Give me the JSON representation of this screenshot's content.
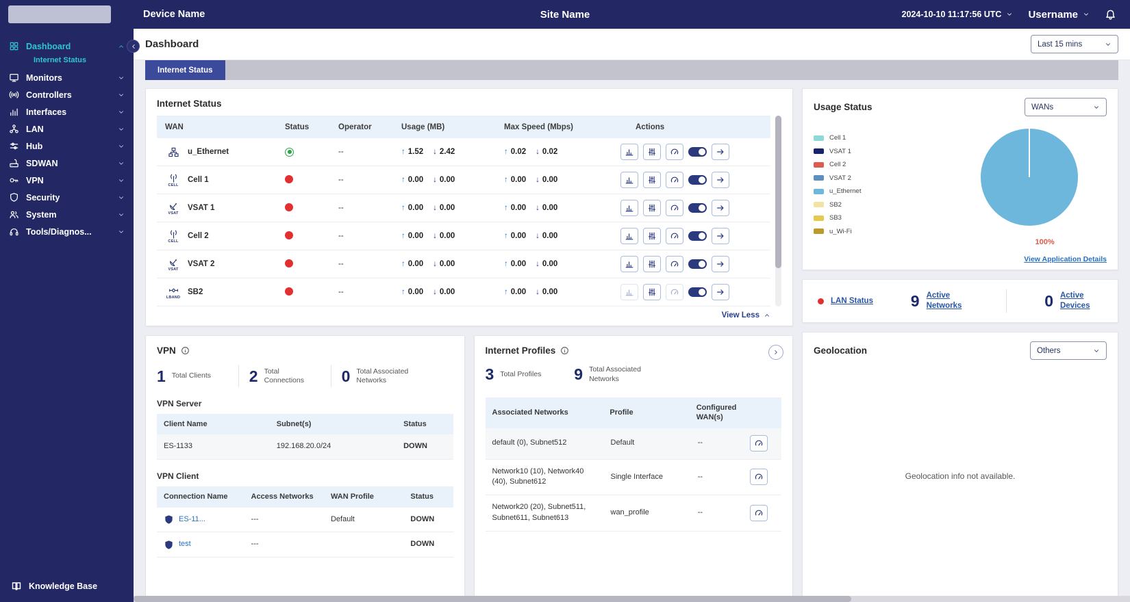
{
  "topbar": {
    "device_name": "Device Name",
    "site_name": "Site Name",
    "datetime": "2024-10-10 11:17:56 UTC",
    "username": "Username"
  },
  "sidebar": {
    "items": [
      {
        "label": "Dashboard"
      },
      {
        "label": "Internet Status"
      },
      {
        "label": "Monitors"
      },
      {
        "label": "Controllers"
      },
      {
        "label": "Interfaces"
      },
      {
        "label": "LAN"
      },
      {
        "label": "Hub"
      },
      {
        "label": "SDWAN"
      },
      {
        "label": "VPN"
      },
      {
        "label": "Security"
      },
      {
        "label": "System"
      },
      {
        "label": "Tools/Diagnos..."
      }
    ],
    "footer": "Knowledge Base"
  },
  "page": {
    "title": "Dashboard",
    "time_filter": "Last 15 mins",
    "tab": "Internet Status"
  },
  "icons": {
    "up_arrow": "↑",
    "down_arrow": "↓"
  },
  "internet_status": {
    "title": "Internet Status",
    "columns": [
      "WAN",
      "Status",
      "Operator",
      "Usage (MB)",
      "Max Speed (Mbps)",
      "Actions"
    ],
    "rows": [
      {
        "wan": "u_Ethernet",
        "type": "ethernet",
        "type_label": "",
        "status": "up",
        "operator": "--",
        "usage_up": "1.52",
        "usage_down": "2.42",
        "max_up": "0.02",
        "max_down": "0.02"
      },
      {
        "wan": "Cell 1",
        "type": "cell",
        "type_label": "CELL",
        "status": "down",
        "operator": "--",
        "usage_up": "0.00",
        "usage_down": "0.00",
        "max_up": "0.00",
        "max_down": "0.00"
      },
      {
        "wan": "VSAT 1",
        "type": "vsat",
        "type_label": "VSAT",
        "status": "down",
        "operator": "--",
        "usage_up": "0.00",
        "usage_down": "0.00",
        "max_up": "0.00",
        "max_down": "0.00"
      },
      {
        "wan": "Cell 2",
        "type": "cell",
        "type_label": "CELL",
        "status": "down",
        "operator": "--",
        "usage_up": "0.00",
        "usage_down": "0.00",
        "max_up": "0.00",
        "max_down": "0.00"
      },
      {
        "wan": "VSAT 2",
        "type": "vsat",
        "type_label": "VSAT",
        "status": "down",
        "operator": "--",
        "usage_up": "0.00",
        "usage_down": "0.00",
        "max_up": "0.00",
        "max_down": "0.00"
      },
      {
        "wan": "SB2",
        "type": "lband",
        "type_label": "LBAND",
        "status": "down",
        "operator": "--",
        "usage_up": "0.00",
        "usage_down": "0.00",
        "max_up": "0.00",
        "max_down": "0.00"
      }
    ],
    "view_less_label": "View Less"
  },
  "usage_status": {
    "title": "Usage Status",
    "filter": "WANs",
    "legend": [
      {
        "label": "Cell 1",
        "color": "#8ed8d8"
      },
      {
        "label": "VSAT 1",
        "color": "#16226b"
      },
      {
        "label": "Cell 2",
        "color": "#df5b50"
      },
      {
        "label": "VSAT 2",
        "color": "#5d8fc0"
      },
      {
        "label": "u_Ethernet",
        "color": "#6db7dc"
      },
      {
        "label": "SB2",
        "color": "#f2e3a4"
      },
      {
        "label": "SB3",
        "color": "#e5c84e"
      },
      {
        "label": "u_Wi-Fi",
        "color": "#bb9a2d"
      }
    ],
    "chart_data": {
      "type": "pie",
      "labels": [
        "Cell 1",
        "VSAT 1",
        "Cell 2",
        "VSAT 2",
        "u_Ethernet",
        "SB2",
        "SB3",
        "u_Wi-Fi"
      ],
      "values": [
        0,
        0,
        0,
        0,
        100,
        0,
        0,
        0
      ],
      "title": "Usage Status",
      "annotation": "100%",
      "legend_position": "left"
    },
    "pie_label": "100%",
    "pie_color": "#6db7dc",
    "details_link": "View Application Details"
  },
  "lan_status": {
    "label": "LAN Status",
    "networks_value": "9",
    "networks_label": "Active Networks",
    "devices_value": "0",
    "devices_label": "Active Devices"
  },
  "vpn": {
    "title": "VPN",
    "stats": [
      {
        "value": "1",
        "label": "Total Clients"
      },
      {
        "value": "2",
        "label": "Total Connections"
      },
      {
        "value": "0",
        "label": "Total Associated Networks"
      }
    ],
    "server": {
      "title": "VPN Server",
      "columns": [
        "Client Name",
        "Subnet(s)",
        "Status"
      ],
      "rows": [
        {
          "client_name": "ES-1133",
          "subnets": "192.168.20.0/24",
          "status": "DOWN"
        }
      ]
    },
    "client": {
      "title": "VPN Client",
      "columns": [
        "Connection Name",
        "Access Networks",
        "WAN Profile",
        "Status"
      ],
      "rows": [
        {
          "connection_name": "ES-11...",
          "access_networks": "---",
          "wan_profile": "Default",
          "status": "DOWN"
        },
        {
          "connection_name": "test",
          "access_networks": "---",
          "wan_profile": "",
          "status": "DOWN"
        }
      ]
    }
  },
  "internet_profiles": {
    "title": "Internet Profiles",
    "stats": [
      {
        "value": "3",
        "label": "Total Profiles"
      },
      {
        "value": "9",
        "label": "Total Associated Networks"
      }
    ],
    "columns": [
      "Associated Networks",
      "Profile",
      "Configured WAN(s)"
    ],
    "rows": [
      {
        "networks": "default (0), Subnet512",
        "profile": "Default",
        "wans": "--"
      },
      {
        "networks": "Network10 (10), Network40 (40), Subnet612",
        "profile": "Single Interface",
        "wans": "--"
      },
      {
        "networks": "Network20 (20), Subnet511, Subnet611, Subnet613",
        "profile": "wan_profile",
        "wans": "--"
      }
    ]
  },
  "geolocation": {
    "title": "Geolocation",
    "filter": "Others",
    "message": "Geolocation info not available."
  }
}
